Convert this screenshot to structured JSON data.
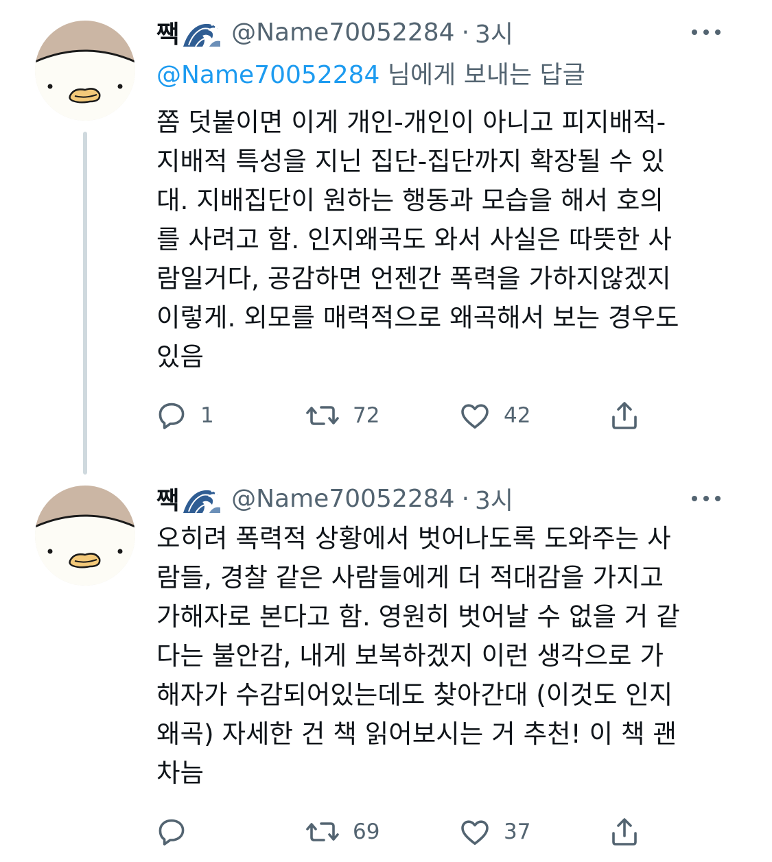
{
  "tweets": [
    {
      "author": {
        "display_name": "짹",
        "display_icon": "wave-icon",
        "handle": "@Name70052284",
        "avatar": "duck-avatar"
      },
      "separator": "·",
      "time": "3시",
      "reply_to": {
        "mention": "@Name70052284",
        "suffix": " 님에게 보내는 답글"
      },
      "text_lines": [
        "쫌 덧붙이면 이게 개인-개인이 아니고 피지배적-",
        "지배적 특성을 지닌 집단-집단까지 확장될 수 있",
        "대. 지배집단이 원하는 행동과 모습을 해서 호의",
        "를 사려고 함. 인지왜곡도 와서 사실은 따뜻한 사",
        "람일거다, 공감하면 언젠간 폭력을 가하지않겠지",
        "이렇게. 외모를 매력적으로 왜곡해서 보는 경우도",
        "있음"
      ],
      "actions": {
        "reply_count": "1",
        "retweet_count": "72",
        "like_count": "42"
      }
    },
    {
      "author": {
        "display_name": "짹",
        "display_icon": "wave-icon",
        "handle": "@Name70052284",
        "avatar": "duck-avatar"
      },
      "separator": "·",
      "time": "3시",
      "text_lines": [
        "오히려 폭력적 상황에서 벗어나도록 도와주는 사",
        "람들, 경찰 같은 사람들에게 더 적대감을 가지고",
        "가해자로 본다고 함. 영원히 벗어날 수 없을 거 같",
        "다는 불안감, 내게 보복하겠지 이런 생각으로 가",
        "해자가 수감되어있는데도 찾아간대 (이것도 인지",
        "왜곡) 자세한 건 책 읽어보시는 거 추천! 이 책 괜",
        "차늠"
      ],
      "actions": {
        "reply_count": "",
        "retweet_count": "69",
        "like_count": "37"
      }
    }
  ],
  "colors": {
    "text_primary": "#0f1419",
    "text_secondary": "#536471",
    "mention": "#1d9bf0",
    "thread_line": "#cfd9de"
  }
}
